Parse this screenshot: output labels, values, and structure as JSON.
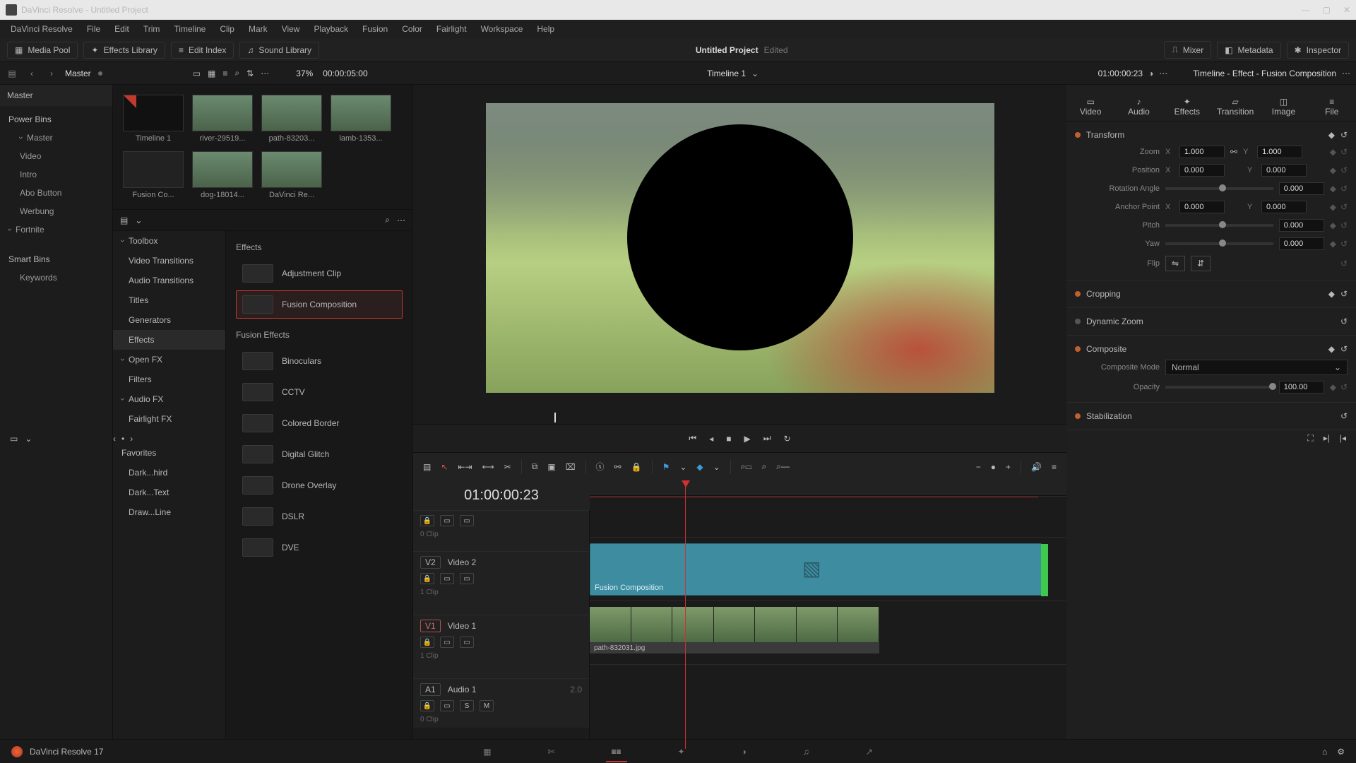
{
  "titlebar": {
    "text": "DaVinci Resolve - Untitled Project"
  },
  "menu": [
    "DaVinci Resolve",
    "File",
    "Edit",
    "Trim",
    "Timeline",
    "Clip",
    "Mark",
    "View",
    "Playback",
    "Fusion",
    "Color",
    "Fairlight",
    "Workspace",
    "Help"
  ],
  "toolbar": {
    "mediaPool": "Media Pool",
    "effectsLib": "Effects Library",
    "editIndex": "Edit Index",
    "soundLib": "Sound Library",
    "project": "Untitled Project",
    "edited": "Edited",
    "mixer": "Mixer",
    "metadata": "Metadata",
    "inspector": "Inspector"
  },
  "crumb": {
    "master": "Master",
    "zoom": "37%",
    "duration": "00:00:05:00",
    "timeline": "Timeline 1",
    "tc": "01:00:00:23",
    "inspectTitle": "Timeline - Effect - Fusion Composition"
  },
  "bins": {
    "master": "Master",
    "powerHdr": "Power Bins",
    "powerItems": [
      "Master",
      "Video",
      "Intro",
      "Abo Button",
      "Werbung",
      "Fortnite"
    ],
    "smartHdr": "Smart Bins",
    "smartItems": [
      "Keywords"
    ]
  },
  "media": [
    {
      "label": "Timeline 1",
      "cls": "tl"
    },
    {
      "label": "river-29519...",
      "cls": ""
    },
    {
      "label": "path-83203...",
      "cls": ""
    },
    {
      "label": "lamb-1353...",
      "cls": ""
    },
    {
      "label": "Fusion Co...",
      "cls": "fc"
    },
    {
      "label": "dog-18014...",
      "cls": ""
    },
    {
      "label": "DaVinci Re...",
      "cls": ""
    }
  ],
  "effTree": {
    "toolbox": "Toolbox",
    "vtrans": "Video Transitions",
    "atrans": "Audio Transitions",
    "titles": "Titles",
    "gens": "Generators",
    "effects": "Effects",
    "openfx": "Open FX",
    "filters": "Filters",
    "audiofx": "Audio FX",
    "fairfx": "Fairlight FX",
    "fav": "Favorites",
    "f1": "Dark...hird",
    "f2": "Dark...Text",
    "f3": "Draw...Line"
  },
  "effList": {
    "hdrEffects": "Effects",
    "adj": "Adjustment Clip",
    "fusion": "Fusion Composition",
    "hdrFusion": "Fusion Effects",
    "items": [
      "Binoculars",
      "CCTV",
      "Colored Border",
      "Digital Glitch",
      "Drone Overlay",
      "DSLR",
      "DVE"
    ]
  },
  "timeline": {
    "tc": "01:00:00:23",
    "v2": {
      "tag": "V2",
      "name": "Video 2",
      "clip": "Fusion Composition"
    },
    "v1": {
      "tag": "V1",
      "name": "Video 1",
      "file": "path-832031.jpg",
      "sub": "1 Clip"
    },
    "v3": {
      "sub": "0 Clip"
    },
    "a1": {
      "tag": "A1",
      "name": "Audio 1",
      "ch": "2.0",
      "sub": "0 Clip"
    }
  },
  "inspector": {
    "tabs": [
      "Video",
      "Audio",
      "Effects",
      "Transition",
      "Image",
      "File"
    ],
    "transform": {
      "hdr": "Transform",
      "zoom": "Zoom",
      "zx": "1.000",
      "zy": "1.000",
      "pos": "Position",
      "px": "0.000",
      "py": "0.000",
      "rot": "Rotation Angle",
      "rv": "0.000",
      "anchor": "Anchor Point",
      "ax": "0.000",
      "ay": "0.000",
      "pitch": "Pitch",
      "pv": "0.000",
      "yaw": "Yaw",
      "yv": "0.000",
      "flip": "Flip"
    },
    "cropping": "Cropping",
    "dynzoom": "Dynamic Zoom",
    "composite": "Composite",
    "compMode": "Composite Mode",
    "compVal": "Normal",
    "opacity": "Opacity",
    "opVal": "100.00",
    "stab": "Stabilization"
  },
  "version": "DaVinci Resolve 17"
}
